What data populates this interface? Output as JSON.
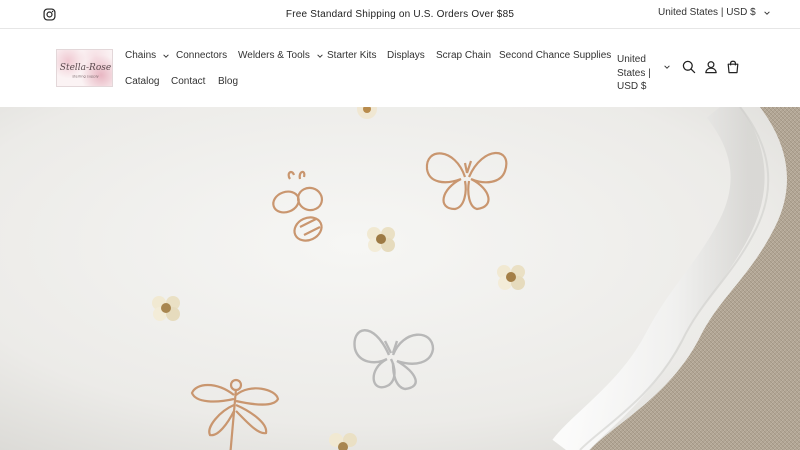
{
  "announcement": {
    "message": "Free Standard Shipping on U.S. Orders Over $85",
    "country_selector": "United States | USD $"
  },
  "header": {
    "logo_text": "Stella-Rose",
    "logo_subtext": "sterling supply",
    "nav": [
      {
        "label": "Chains",
        "has_dropdown": true
      },
      {
        "label": "Connectors",
        "has_dropdown": false
      },
      {
        "label": "Welders & Tools",
        "has_dropdown": true
      },
      {
        "label": "Starter Kits",
        "has_dropdown": false
      },
      {
        "label": "Displays",
        "has_dropdown": false
      },
      {
        "label": "Scrap Chain",
        "has_dropdown": false
      },
      {
        "label": "Second Chance Supplies",
        "has_dropdown": false
      },
      {
        "label": "Catalog",
        "has_dropdown": false
      },
      {
        "label": "Contact",
        "has_dropdown": false
      },
      {
        "label": "Blog",
        "has_dropdown": false
      }
    ],
    "country_selector": {
      "line1": "United",
      "line2": "States |",
      "line3": "USD $"
    },
    "icons": [
      "search-icon",
      "account-icon",
      "cart-icon"
    ]
  },
  "hero": {
    "charms": [
      "bee",
      "butterfly",
      "butterfly",
      "dragonfly"
    ],
    "colors": {
      "gold": "#c9966f",
      "silver": "#b8b8b8",
      "plate": "#f3f3f1",
      "linen": "#b6aa9a"
    }
  }
}
